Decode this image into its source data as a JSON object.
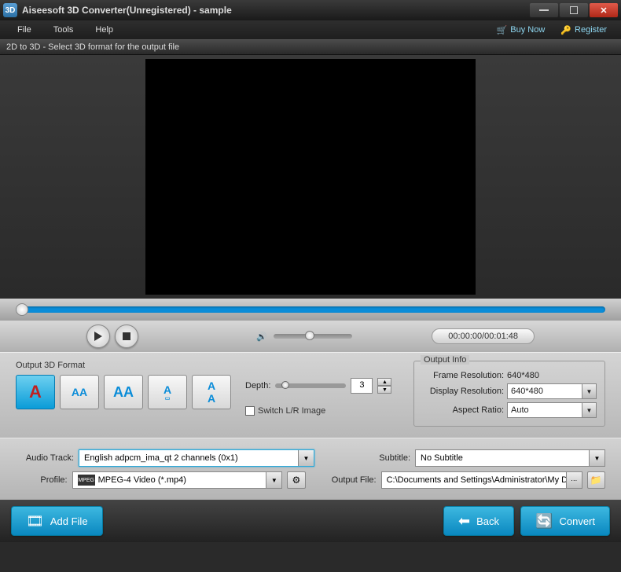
{
  "title": "Aiseesoft 3D Converter(Unregistered) - sample",
  "menu": {
    "file": "File",
    "tools": "Tools",
    "help": "Help",
    "buy": "Buy Now",
    "register": "Register"
  },
  "infobar": "2D to 3D - Select 3D format for the output file",
  "time": "00:00:00/00:01:48",
  "format": {
    "label": "Output 3D Format",
    "b1": "A",
    "b2": "AA",
    "b3": "AA",
    "b4": "A",
    "b5": "A"
  },
  "depth": {
    "label": "Depth:",
    "value": "3"
  },
  "switch_lr": "Switch L/R Image",
  "output_info": {
    "legend": "Output Info",
    "frame_label": "Frame Resolution:",
    "frame_value": "640*480",
    "display_label": "Display Resolution:",
    "display_value": "640*480",
    "aspect_label": "Aspect Ratio:",
    "aspect_value": "Auto"
  },
  "audio": {
    "label": "Audio Track:",
    "value": "English adpcm_ima_qt 2 channels (0x1)"
  },
  "subtitle": {
    "label": "Subtitle:",
    "value": "No Subtitle"
  },
  "profile": {
    "label": "Profile:",
    "icon": "MPEG",
    "value": "MPEG-4 Video (*.mp4)"
  },
  "output_file": {
    "label": "Output File:",
    "value": "C:\\Documents and Settings\\Administrator\\My Doc"
  },
  "buttons": {
    "add": "Add File",
    "back": "Back",
    "convert": "Convert"
  }
}
